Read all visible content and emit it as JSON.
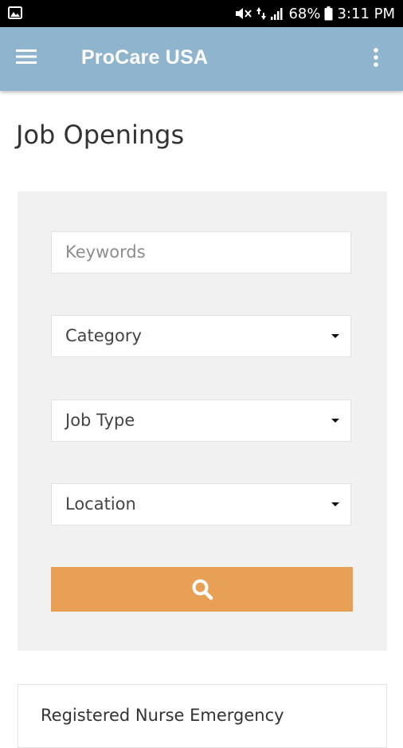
{
  "status_bar": {
    "battery": "68%",
    "time": "3:11 PM",
    "icons": [
      "image-icon",
      "mute-icon",
      "data-icon",
      "signal-icon",
      "battery-icon"
    ]
  },
  "app_bar": {
    "title": "ProCare USA",
    "icons": [
      "menu-icon",
      "more-vert-icon"
    ],
    "background": "#8fb4ce"
  },
  "page": {
    "title": "Job Openings"
  },
  "search": {
    "keywords_placeholder": "Keywords",
    "category_value": "Category",
    "job_type_value": "Job Type",
    "location_value": "Location",
    "button_icon": "search-icon",
    "button_color": "#e8a054"
  },
  "jobs": [
    {
      "title": "Registered Nurse Emergency"
    }
  ]
}
